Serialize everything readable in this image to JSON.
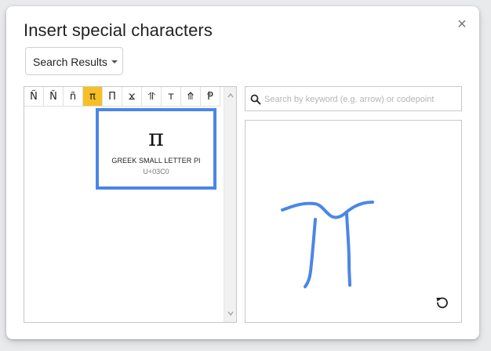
{
  "dialog": {
    "title": "Insert special characters",
    "close_glyph": "×"
  },
  "category_dropdown": {
    "selected": "Search Results"
  },
  "character_grid": {
    "cells": [
      "Ñ",
      "Ň",
      "ñ",
      "π",
      "Π",
      "ϫ",
      "⥣",
      "ᴛ",
      "⤊",
      "Ᵽ"
    ],
    "selected_index": 3
  },
  "preview": {
    "glyph": "π",
    "name": "GREEK SMALL LETTER PI",
    "codepoint": "U+03C0"
  },
  "search": {
    "placeholder": "Search by keyword (e.g. arrow) or codepoint",
    "value": ""
  },
  "drawing": {
    "icon": "reset-icon"
  },
  "colors": {
    "accent": "#4a86e8",
    "selected_cell": "#f6bf26",
    "stroke": "#4a86e8"
  }
}
